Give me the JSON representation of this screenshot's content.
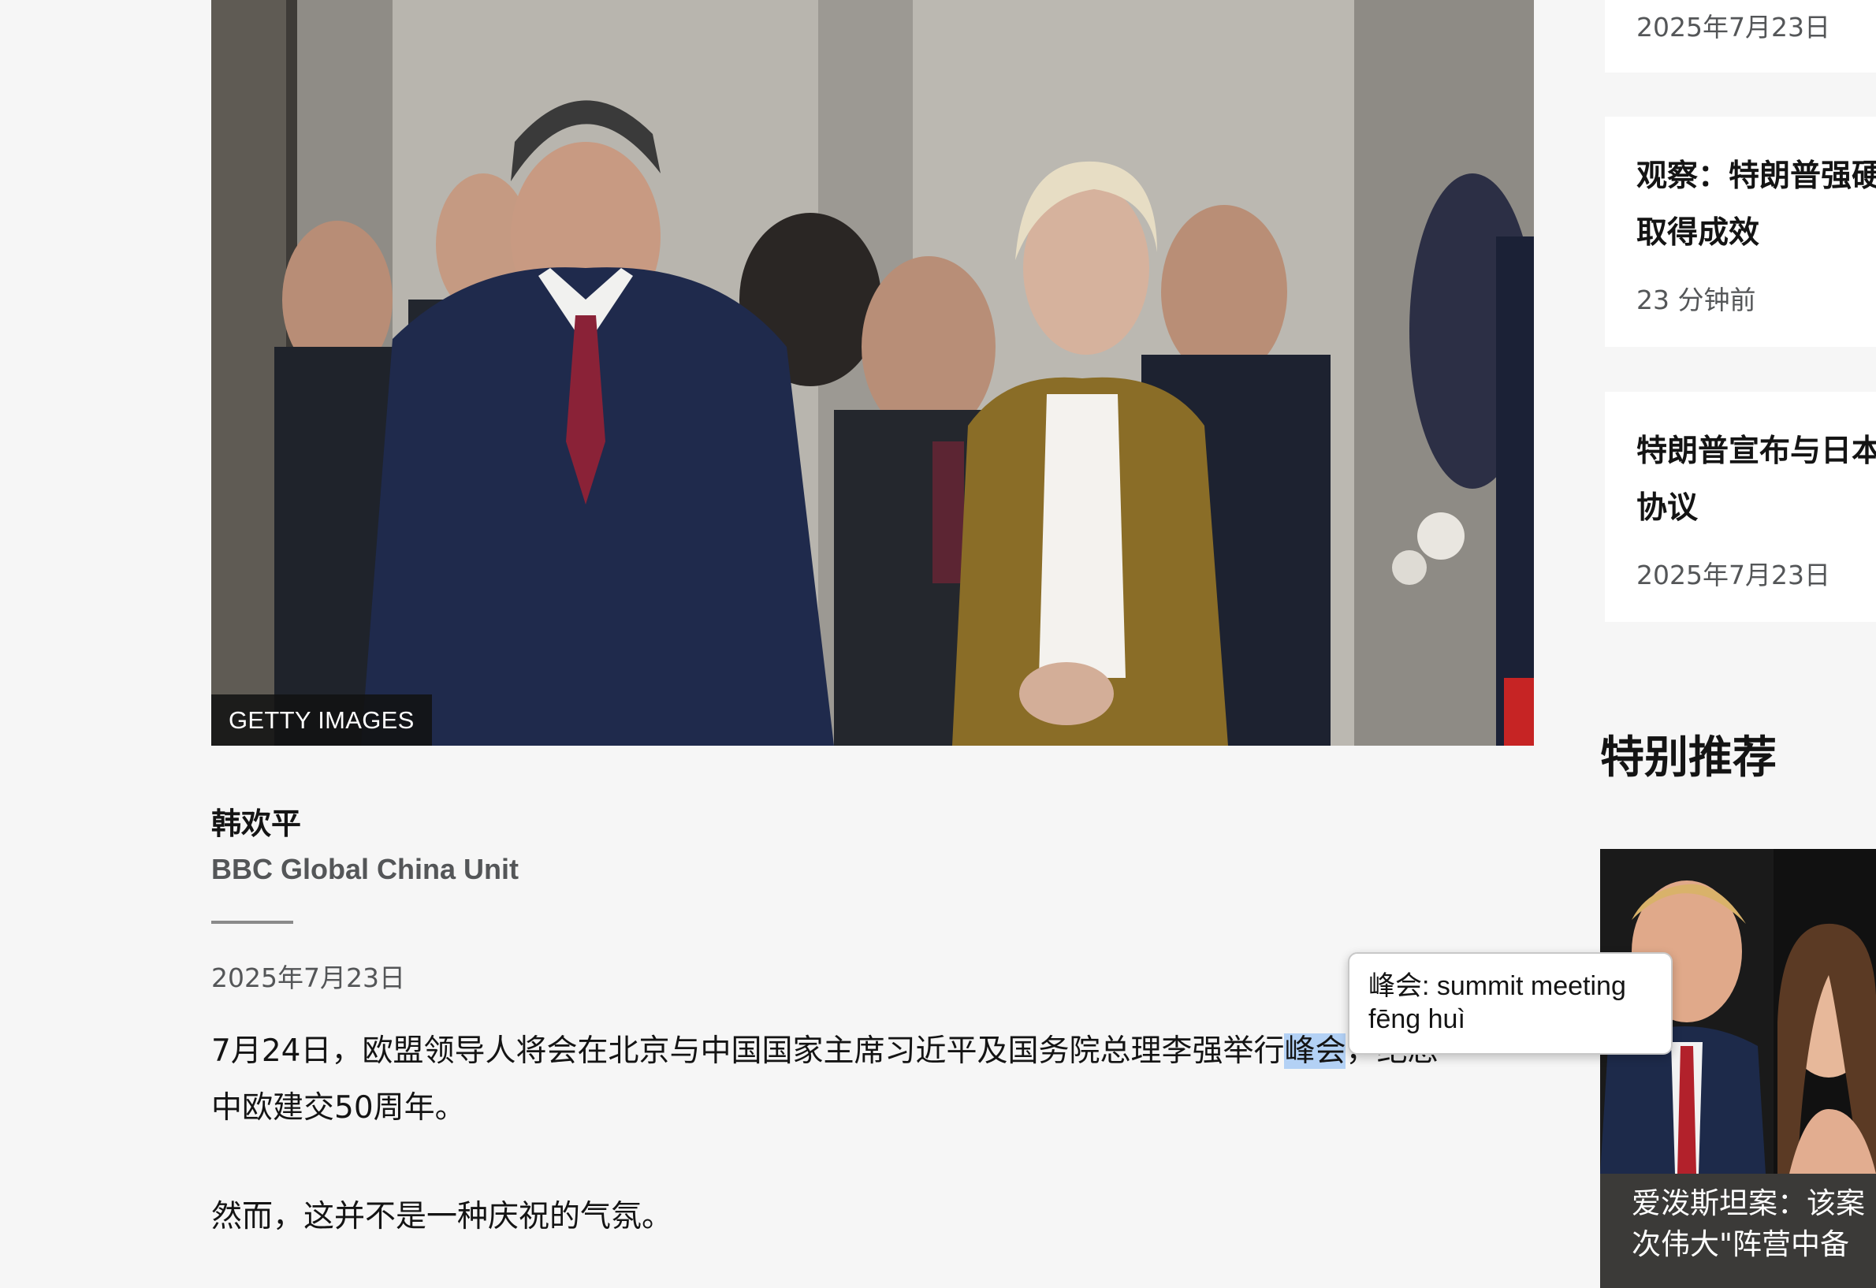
{
  "article": {
    "image_credit": "GETTY IMAGES",
    "author_name": "韩欢平",
    "author_unit": "BBC Global China Unit",
    "published_date": "2025年7月23日",
    "paragraph_1_before": "7月24日，欧盟领导人将会在北京与中国国家主席习近平及国务院总理李强举行",
    "paragraph_1_highlight": "峰会",
    "paragraph_1_after": "，纪念中欧建交50周年。",
    "paragraph_2": "然而，这并不是一种庆祝的气氛。"
  },
  "sidebar": {
    "top_card_date": "2025年7月23日",
    "cards": [
      {
        "title": "观察：特朗普强硬贸易政策取得成效",
        "meta": "23 分钟前"
      },
      {
        "title": "特朗普宣布与日本达成贸易协议",
        "meta": "2025年7月23日"
      }
    ],
    "section_heading": "特别推荐",
    "promo_caption_line_1": "爱泼斯坦案：该案",
    "promo_caption_line_2": "次伟大\"阵营中备"
  },
  "tooltip": {
    "definition": "峰会: summit meeting",
    "pinyin": "fēng huì"
  },
  "colors": {
    "page_background": "#f6f6f6",
    "card_background": "#ffffff",
    "text_primary": "#141414",
    "text_secondary": "#545658",
    "highlight": "#b3d1f5"
  }
}
